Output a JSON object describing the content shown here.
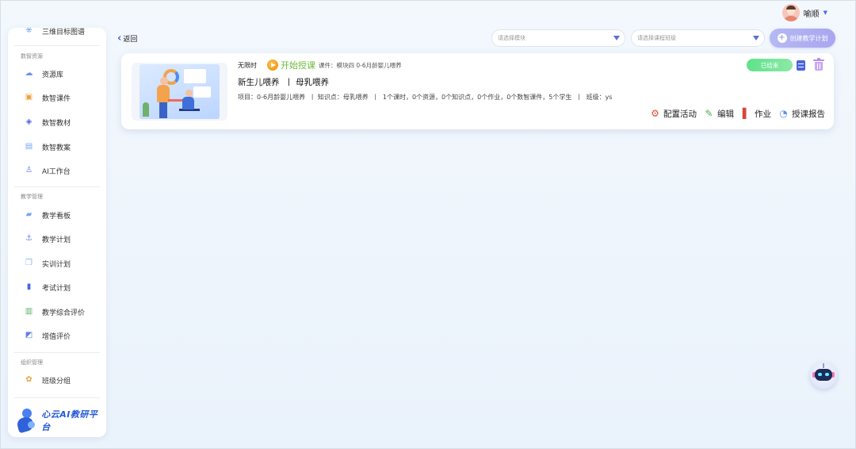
{
  "header": {
    "user_name": "喻顺"
  },
  "sidebar": {
    "top_item": "三维目标图谱",
    "sections": [
      {
        "title": "数智资源",
        "items": [
          {
            "label": "资源库",
            "icon": "cloud-icon"
          },
          {
            "label": "数智课件",
            "icon": "courseware-icon"
          },
          {
            "label": "数智教材",
            "icon": "textbook-icon"
          },
          {
            "label": "数智教案",
            "icon": "lesson-plan-icon"
          },
          {
            "label": "AI工作台",
            "icon": "ai-workbench-icon"
          }
        ]
      },
      {
        "title": "教学管理",
        "items": [
          {
            "label": "教学看板",
            "icon": "dashboard-icon"
          },
          {
            "label": "教学计划",
            "icon": "teaching-plan-icon"
          },
          {
            "label": "实训计划",
            "icon": "training-plan-icon"
          },
          {
            "label": "考试计划",
            "icon": "exam-plan-icon"
          },
          {
            "label": "教学综合评价",
            "icon": "evaluation-icon"
          },
          {
            "label": "增值评价",
            "icon": "value-added-icon"
          }
        ]
      },
      {
        "title": "组织管理",
        "items": [
          {
            "label": "班级分组",
            "icon": "class-group-icon"
          }
        ]
      }
    ],
    "brand_name": "心云AI教研平台"
  },
  "toolbar": {
    "back_label": "返回",
    "module_placeholder": "请选择模块",
    "class_placeholder": "请选择课程班级",
    "create_label": "创建教学计划"
  },
  "card": {
    "time_tag": "无限时",
    "start_label": "开始授课",
    "course_info": "课件：模块四 0-6月龄婴儿喂养",
    "title": "新生儿喂养  丨 母乳喂养",
    "meta": "项目：0-6月龄婴儿喂养  丨 知识点：母乳喂养  丨  1个课时，0个资源，0个知识点，0个作业，0个数智课件，5个学生  丨  班级：ys",
    "status": "已结束",
    "actions": [
      {
        "label": "配置活动",
        "icon": "gear-icon"
      },
      {
        "label": "编辑",
        "icon": "edit-icon"
      },
      {
        "label": "作业",
        "icon": "homework-icon"
      },
      {
        "label": "授课报告",
        "icon": "report-icon"
      }
    ]
  },
  "colors": {
    "accent": "#4c63e0",
    "start": "#6fba3e",
    "ended": "#5ee28b",
    "create": "#b5b9f4"
  }
}
